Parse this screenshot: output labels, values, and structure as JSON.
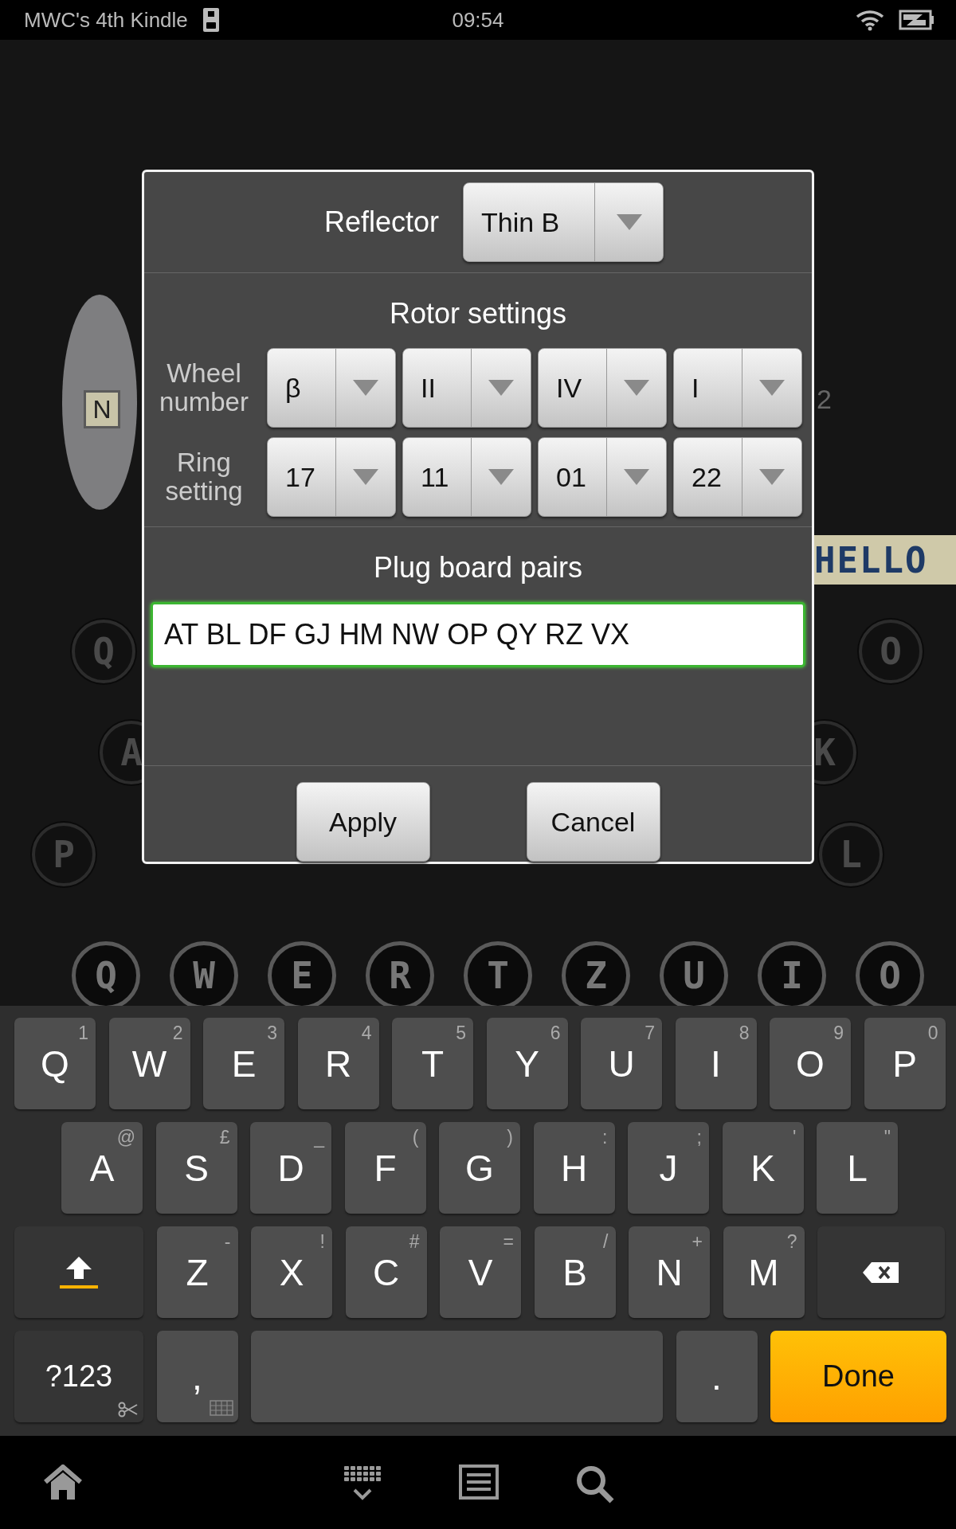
{
  "status_bar": {
    "device_name": "MWC's 4th Kindle",
    "time": "09:54"
  },
  "background": {
    "rotor_letter": "N",
    "rotor_number": "2",
    "tape_text": "HELLO",
    "lamp_rows": [
      [
        "Q",
        "O"
      ],
      [
        "A",
        "K"
      ],
      [
        "P",
        "L"
      ]
    ],
    "keys": [
      "Q",
      "W",
      "E",
      "R",
      "T",
      "Z",
      "U",
      "I",
      "O"
    ]
  },
  "dialog": {
    "reflector": {
      "label": "Reflector",
      "value": "Thin B"
    },
    "rotor_title": "Rotor settings",
    "rotor_rows": [
      {
        "label": "Wheel number",
        "values": [
          "β",
          "II",
          "IV",
          "I"
        ]
      },
      {
        "label": "Ring setting",
        "values": [
          "17",
          "11",
          "01",
          "22"
        ]
      }
    ],
    "plugboard": {
      "label": "Plug board pairs",
      "value": "AT BL DF GJ HM NW OP QY RZ VX",
      "focused": true
    },
    "buttons": [
      "Apply",
      "Cancel"
    ]
  },
  "keyboard": {
    "rows": [
      [
        {
          "kind": "letter",
          "label": "Q",
          "hint": "1"
        },
        {
          "kind": "letter",
          "label": "W",
          "hint": "2"
        },
        {
          "kind": "letter",
          "label": "E",
          "hint": "3"
        },
        {
          "kind": "letter",
          "label": "R",
          "hint": "4"
        },
        {
          "kind": "letter",
          "label": "T",
          "hint": "5"
        },
        {
          "kind": "letter",
          "label": "Y",
          "hint": "6"
        },
        {
          "kind": "letter",
          "label": "U",
          "hint": "7"
        },
        {
          "kind": "letter",
          "label": "I",
          "hint": "8"
        },
        {
          "kind": "letter",
          "label": "O",
          "hint": "9"
        },
        {
          "kind": "letter",
          "label": "P",
          "hint": "0"
        }
      ],
      [
        {
          "kind": "letter",
          "label": "A",
          "hint": "@"
        },
        {
          "kind": "letter",
          "label": "S",
          "hint": "£"
        },
        {
          "kind": "letter",
          "label": "D",
          "hint": "_"
        },
        {
          "kind": "letter",
          "label": "F",
          "hint": "("
        },
        {
          "kind": "letter",
          "label": "G",
          "hint": ")"
        },
        {
          "kind": "letter",
          "label": "H",
          "hint": ":"
        },
        {
          "kind": "letter",
          "label": "J",
          "hint": ";"
        },
        {
          "kind": "letter",
          "label": "K",
          "hint": "'"
        },
        {
          "kind": "letter",
          "label": "L",
          "hint": "\""
        }
      ],
      [
        {
          "kind": "shift"
        },
        {
          "kind": "letter",
          "label": "Z",
          "hint": "-"
        },
        {
          "kind": "letter",
          "label": "X",
          "hint": "!"
        },
        {
          "kind": "letter",
          "label": "C",
          "hint": "#"
        },
        {
          "kind": "letter",
          "label": "V",
          "hint": "="
        },
        {
          "kind": "letter",
          "label": "B",
          "hint": "/"
        },
        {
          "kind": "letter",
          "label": "N",
          "hint": "+"
        },
        {
          "kind": "letter",
          "label": "M",
          "hint": "?"
        },
        {
          "kind": "backspace"
        }
      ],
      [
        {
          "kind": "symbols",
          "label": "?123"
        },
        {
          "kind": "comma",
          "label": ","
        },
        {
          "kind": "space"
        },
        {
          "kind": "period",
          "label": "."
        },
        {
          "kind": "done",
          "label": "Done"
        }
      ]
    ]
  }
}
